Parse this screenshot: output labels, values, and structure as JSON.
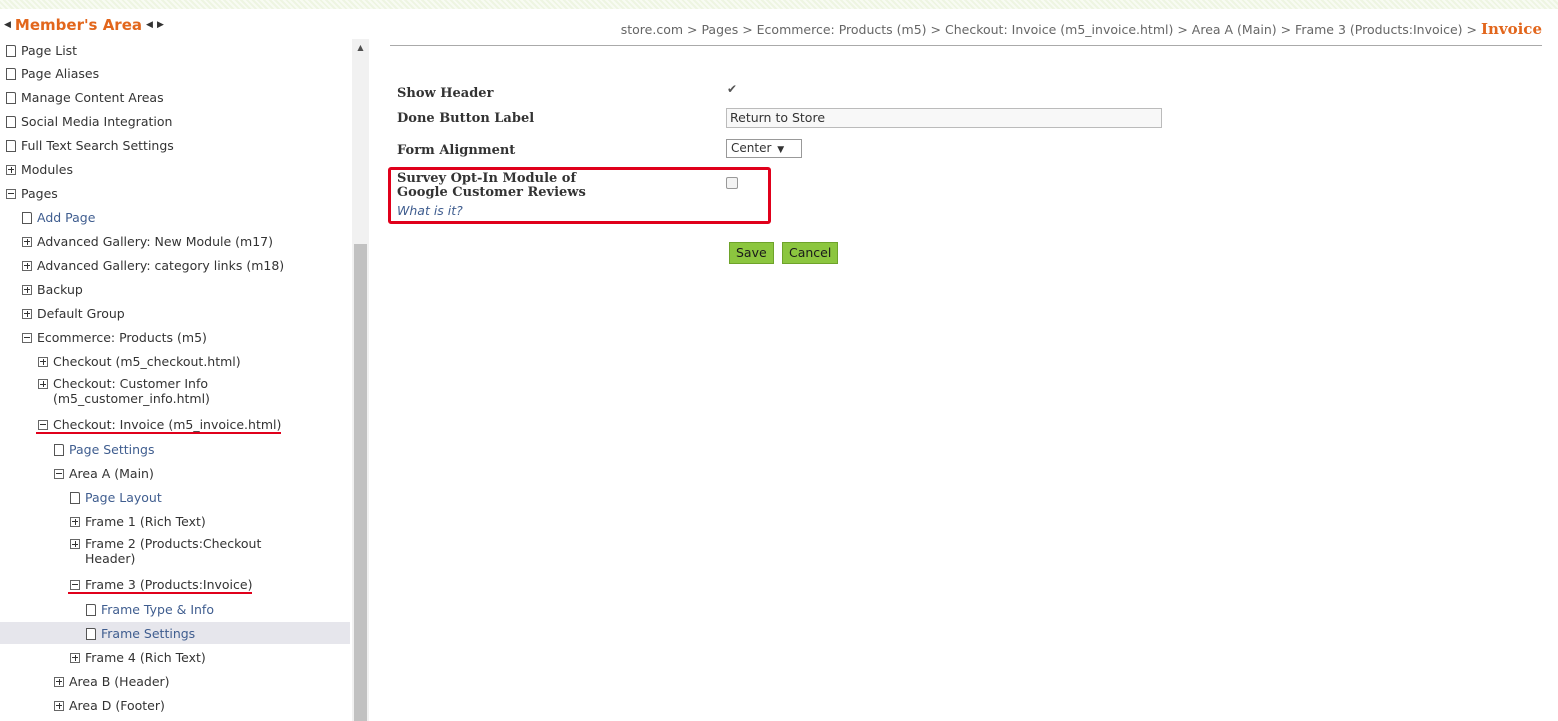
{
  "sidebar": {
    "title": "Member's Area",
    "prev_arrow": "◀",
    "next_arrow": "▶",
    "items": [
      {
        "label": "Page List",
        "icon": "page-icon"
      },
      {
        "label": "Page Aliases",
        "icon": "page-icon"
      },
      {
        "label": "Manage Content Areas",
        "icon": "page-icon"
      },
      {
        "label": "Social Media Integration",
        "icon": "page-icon"
      },
      {
        "label": "Full Text Search Settings",
        "icon": "page-icon"
      },
      {
        "label": "Modules",
        "icon": "expand-icon"
      },
      {
        "label": "Pages",
        "icon": "collapse-icon"
      },
      {
        "label": "Add Page",
        "icon": "page-icon"
      },
      {
        "label": "Advanced Gallery: New Module (m17)",
        "icon": "expand-icon"
      },
      {
        "label": "Advanced Gallery: category links (m18)",
        "icon": "expand-icon"
      },
      {
        "label": "Backup",
        "icon": "expand-icon"
      },
      {
        "label": "Default Group",
        "icon": "expand-icon"
      },
      {
        "label": "Ecommerce: Products (m5)",
        "icon": "collapse-icon"
      },
      {
        "label": "Checkout (m5_checkout.html)",
        "icon": "expand-icon"
      },
      {
        "label": "Checkout: Customer Info (m5_customer_info.html)",
        "icon": "expand-icon"
      },
      {
        "label": "Checkout: Invoice (m5_invoice.html)",
        "icon": "collapse-icon"
      },
      {
        "label": "Page Settings",
        "icon": "page-icon"
      },
      {
        "label": "Area A (Main)",
        "icon": "collapse-icon"
      },
      {
        "label": "Page Layout",
        "icon": "page-icon"
      },
      {
        "label": "Frame 1 (Rich Text)",
        "icon": "expand-icon"
      },
      {
        "label": "Frame 2 (Products:Checkout Header)",
        "icon": "expand-icon"
      },
      {
        "label": "Frame 3 (Products:Invoice)",
        "icon": "collapse-icon"
      },
      {
        "label": "Frame Type & Info",
        "icon": "page-icon"
      },
      {
        "label": "Frame Settings",
        "icon": "page-icon"
      },
      {
        "label": "Frame 4 (Rich Text)",
        "icon": "expand-icon"
      },
      {
        "label": "Area B (Header)",
        "icon": "expand-icon"
      },
      {
        "label": "Area D (Footer)",
        "icon": "expand-icon"
      }
    ]
  },
  "breadcrumb": {
    "path": "store.com > Pages > Ecommerce: Products (m5) > Checkout: Invoice (m5_invoice.html) > Area A (Main) > Frame 3 (Products:Invoice) >",
    "current": "Invoice"
  },
  "form": {
    "show_header_label": "Show Header",
    "show_header_checked": true,
    "done_button_label_label": "Done Button Label",
    "done_button_label_value": "Return to Store",
    "form_alignment_label": "Form Alignment",
    "form_alignment_value": "Center",
    "survey_label_line1": "Survey Opt-In Module of",
    "survey_label_line2": "Google Customer Reviews",
    "survey_checked": false,
    "what_is_it": "What is it?",
    "save": "Save",
    "cancel": "Cancel"
  },
  "colors": {
    "accent_orange": "#e2661c",
    "button_green": "#8cc63f",
    "highlight_red": "#e0001b",
    "link_blue": "#3f5d8f"
  }
}
